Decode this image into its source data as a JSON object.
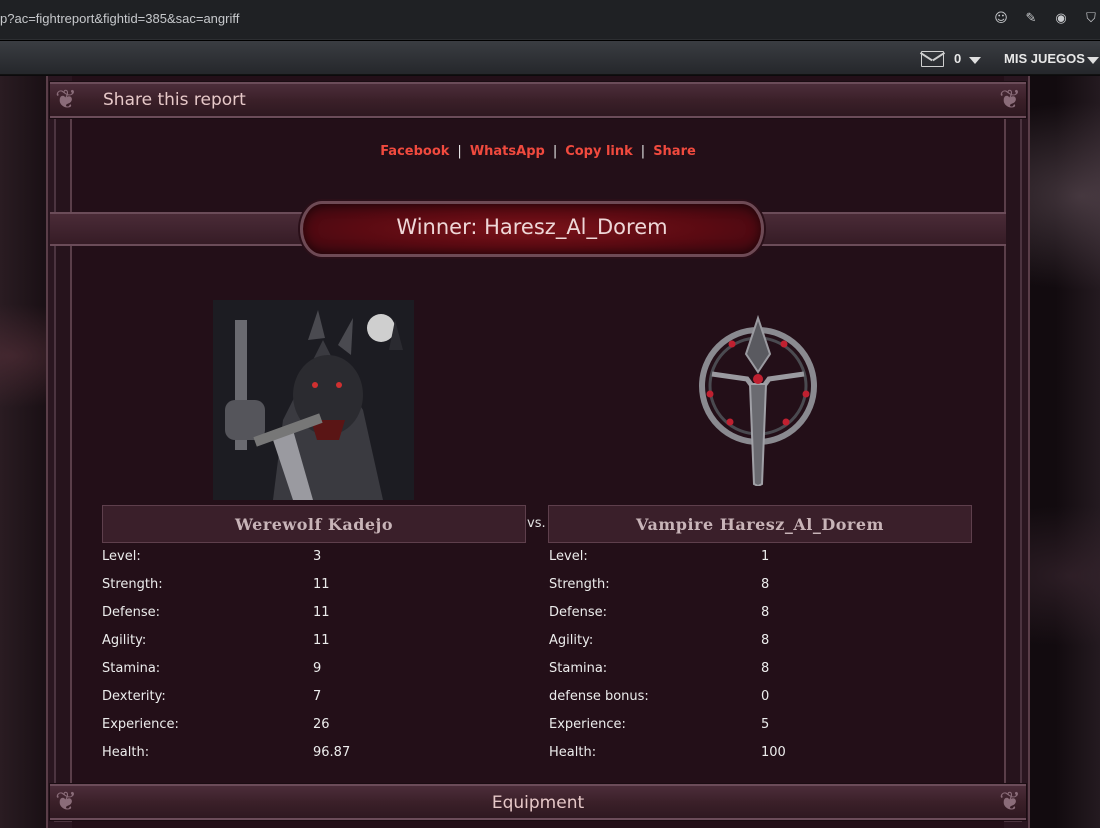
{
  "browser": {
    "url": "p?ac=fightreport&fightid=385&sac=angriff",
    "icons": [
      "smiley-icon",
      "edit-icon",
      "camera-icon",
      "shield-icon"
    ]
  },
  "topbar": {
    "message_count": "0",
    "games_menu": "MIS JUEGOS"
  },
  "share": {
    "title": "Share this report",
    "links": [
      "Facebook",
      "WhatsApp",
      "Copy link",
      "Share"
    ],
    "separator": "|"
  },
  "winner": {
    "text": "Winner: Haresz_Al_Dorem"
  },
  "fighters": {
    "vs": "vs.",
    "left": {
      "name": "Werewolf Kadejo",
      "stats": [
        {
          "label": "Level:",
          "value": "3"
        },
        {
          "label": "Strength:",
          "value": "11"
        },
        {
          "label": "Defense:",
          "value": "11"
        },
        {
          "label": "Agility:",
          "value": "11"
        },
        {
          "label": "Stamina:",
          "value": "9"
        },
        {
          "label": "Dexterity:",
          "value": "7"
        },
        {
          "label": "Experience:",
          "value": "26"
        },
        {
          "label": "Health:",
          "value": "96.87"
        }
      ]
    },
    "right": {
      "name": "Vampire Haresz_Al_Dorem",
      "stats": [
        {
          "label": "Level:",
          "value": "1"
        },
        {
          "label": "Strength:",
          "value": "8"
        },
        {
          "label": "Defense:",
          "value": "8"
        },
        {
          "label": "Agility:",
          "value": "8"
        },
        {
          "label": "Stamina:",
          "value": "8"
        },
        {
          "label": "defense bonus:",
          "value": "0"
        },
        {
          "label": "Experience:",
          "value": "5"
        },
        {
          "label": "Health:",
          "value": "100"
        }
      ]
    }
  },
  "equipment": {
    "title": "Equipment"
  },
  "colors": {
    "link": "#f04a3e",
    "panel": "#230f18",
    "banner": "#7a1219"
  }
}
